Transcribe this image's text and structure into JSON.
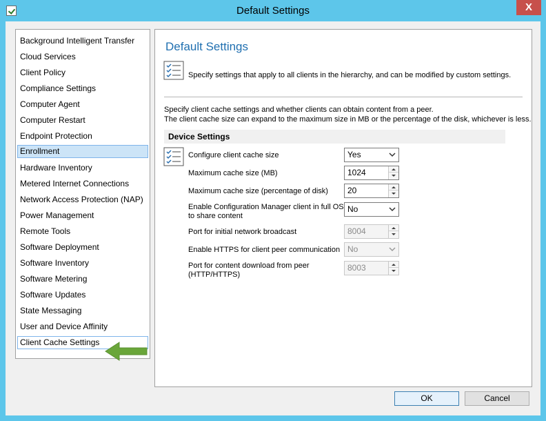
{
  "window": {
    "title": "Default Settings",
    "close_label": "X"
  },
  "nav": {
    "items": [
      "Background Intelligent Transfer",
      "Cloud Services",
      "Client Policy",
      "Compliance Settings",
      "Computer Agent",
      "Computer Restart",
      "Endpoint Protection",
      "Enrollment",
      "Hardware Inventory",
      "Metered Internet Connections",
      "Network Access Protection (NAP)",
      "Power Management",
      "Remote Tools",
      "Software Deployment",
      "Software Inventory",
      "Software Metering",
      "Software Updates",
      "State Messaging",
      "User and Device Affinity",
      "Client Cache Settings"
    ],
    "selected": "Enrollment",
    "focused": "Client Cache Settings"
  },
  "content": {
    "title": "Default Settings",
    "description": "Specify settings that apply to all clients in the hierarchy, and can be modified by custom settings.",
    "info_line1": "Specify client cache settings and whether clients can obtain content from a peer.",
    "info_line2": "The client cache size can expand to the maximum size in MB or the percentage of the disk, whichever is less.",
    "group_header": "Device Settings",
    "settings": [
      {
        "label": "Configure client cache size",
        "value": "Yes"
      },
      {
        "label": "Maximum cache size (MB)",
        "value": "1024"
      },
      {
        "label": "Maximum cache size (percentage of disk)",
        "value": "20"
      },
      {
        "label_line1": "Enable Configuration Manager client in full OS",
        "label_line2": "to share content",
        "value": "No"
      },
      {
        "label": "Port for initial network broadcast",
        "value": "8004"
      },
      {
        "label": "Enable HTTPS for client peer communication",
        "value": "No"
      },
      {
        "label_line1": "Port for content download from peer",
        "label_line2": "(HTTP/HTTPS)",
        "value": "8003"
      }
    ]
  },
  "buttons": {
    "ok": "OK",
    "cancel": "Cancel"
  },
  "colors": {
    "titlebar": "#5dc6ea",
    "close": "#c7504b",
    "accent_title": "#1f6fb0",
    "arrow": "#6aa63a",
    "selection": "#cce4f7"
  }
}
